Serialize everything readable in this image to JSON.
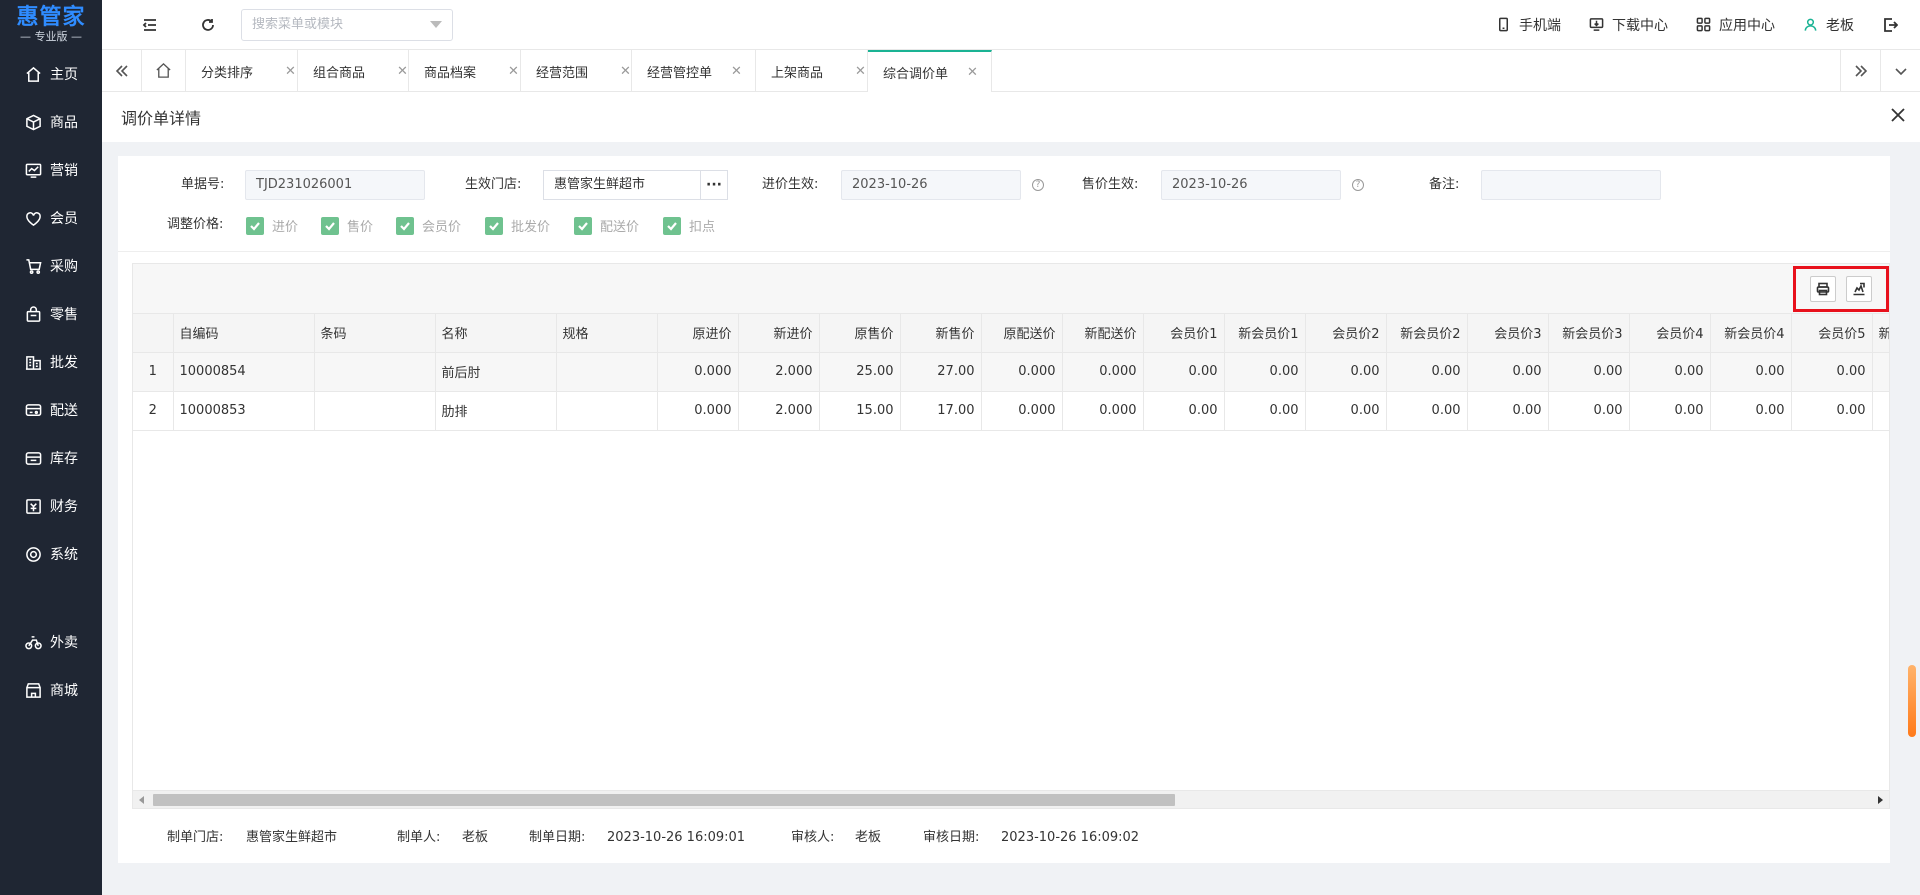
{
  "brand": {
    "title": "惠管家",
    "subtitle": "— 专业版 —"
  },
  "sidebar": {
    "items": [
      {
        "label": "主页",
        "icon": "home-icon"
      },
      {
        "label": "商品",
        "icon": "box-icon"
      },
      {
        "label": "营销",
        "icon": "chart-icon"
      },
      {
        "label": "会员",
        "icon": "heart-icon"
      },
      {
        "label": "采购",
        "icon": "cart-icon"
      },
      {
        "label": "零售",
        "icon": "bag-icon"
      },
      {
        "label": "批发",
        "icon": "building-icon"
      },
      {
        "label": "配送",
        "icon": "truck-icon"
      },
      {
        "label": "库存",
        "icon": "warehouse-icon"
      },
      {
        "label": "财务",
        "icon": "finance-icon"
      },
      {
        "label": "系统",
        "icon": "settings-icon"
      }
    ],
    "extra_items": [
      {
        "label": "外卖",
        "icon": "bike-icon"
      },
      {
        "label": "商城",
        "icon": "store-icon"
      }
    ]
  },
  "header": {
    "search_placeholder": "搜索菜单或模块",
    "mobile": "手机端",
    "download": "下载中心",
    "apps": "应用中心",
    "user": "老板"
  },
  "tabs": [
    {
      "label": "分类排序",
      "active": false
    },
    {
      "label": "组合商品",
      "active": false
    },
    {
      "label": "商品档案",
      "active": false
    },
    {
      "label": "经营范围",
      "active": false
    },
    {
      "label": "经营管控单",
      "active": false
    },
    {
      "label": "上架商品",
      "active": false
    },
    {
      "label": "综合调价单",
      "active": true
    }
  ],
  "page": {
    "title": "调价单详情"
  },
  "form": {
    "doc_no_label": "单据号:",
    "doc_no": "TJD231026001",
    "store_label": "生效门店:",
    "store": "惠管家生鲜超市",
    "store_btn": "···",
    "purchase_eff_label": "进价生效:",
    "purchase_eff": "2023-10-26",
    "sale_eff_label": "售价生效:",
    "sale_eff": "2023-10-26",
    "note_label": "备注:",
    "note": "",
    "adjust_label": "调整价格:",
    "checks": [
      "进价",
      "售价",
      "会员价",
      "批发价",
      "配送价",
      "扣点"
    ]
  },
  "grid": {
    "columns": [
      "自编码",
      "条码",
      "名称",
      "规格",
      "原进价",
      "新进价",
      "原售价",
      "新售价",
      "原配送价",
      "新配送价",
      "会员价1",
      "新会员价1",
      "会员价2",
      "新会员价2",
      "会员价3",
      "新会员价3",
      "会员价4",
      "新会员价4",
      "会员价5",
      "新"
    ],
    "rows": [
      {
        "index": "1",
        "cells": [
          "10000854",
          "",
          "前后肘",
          "",
          "0.000",
          "2.000",
          "25.00",
          "27.00",
          "0.000",
          "0.000",
          "0.00",
          "0.00",
          "0.00",
          "0.00",
          "0.00",
          "0.00",
          "0.00",
          "0.00",
          "0.00",
          ""
        ]
      },
      {
        "index": "2",
        "cells": [
          "10000853",
          "",
          "肋排",
          "",
          "0.000",
          "2.000",
          "15.00",
          "17.00",
          "0.000",
          "0.000",
          "0.00",
          "0.00",
          "0.00",
          "0.00",
          "0.00",
          "0.00",
          "0.00",
          "0.00",
          "0.00",
          ""
        ]
      }
    ]
  },
  "footer": {
    "store_label": "制单门店:",
    "store": "惠管家生鲜超市",
    "maker_label": "制单人:",
    "maker": "老板",
    "make_date_label": "制单日期:",
    "make_date": "2023-10-26 16:09:01",
    "auditor_label": "审核人:",
    "auditor": "老板",
    "audit_date_label": "审核日期:",
    "audit_date": "2023-10-26 16:09:02"
  },
  "colors": {
    "sidebar_bg": "#1f2633",
    "brand_blue": "#2f8cff",
    "accent_green": "#1ab394",
    "highlight_red": "#e8111c"
  }
}
